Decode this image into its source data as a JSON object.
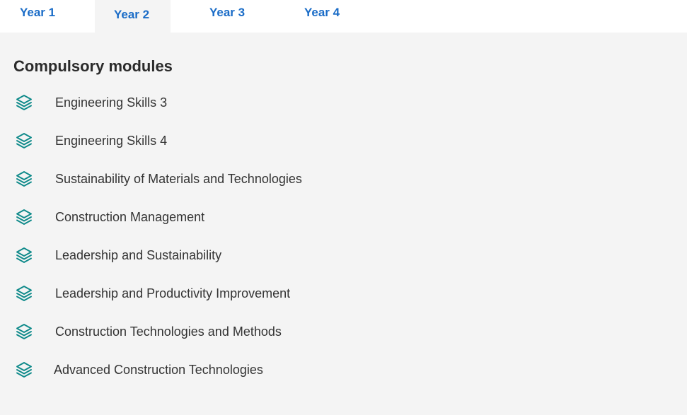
{
  "tabs": [
    {
      "label": "Year 1",
      "active": false
    },
    {
      "label": "Year 2",
      "active": true
    },
    {
      "label": "Year 3",
      "active": false
    },
    {
      "label": "Year 4",
      "active": false
    }
  ],
  "section": {
    "title": "Compulsory modules"
  },
  "modules": [
    {
      "label": "Engineering Skills 3",
      "icon": "stack-layers-icon"
    },
    {
      "label": "Engineering Skills 4",
      "icon": "stack-layers-icon"
    },
    {
      "label": "Sustainability of Materials and Technologies",
      "icon": "stack-layers-icon"
    },
    {
      "label": "Construction Management",
      "icon": "stack-layers-icon"
    },
    {
      "label": "Leadership and Sustainability",
      "icon": "stack-layers-icon"
    },
    {
      "label": "Leadership and Productivity Improvement",
      "icon": "stack-layers-icon"
    },
    {
      "label": "Construction Technologies and Methods",
      "icon": "stack-layers-icon"
    },
    {
      "label": "Advanced Construction Technologies",
      "icon": "stack-layers-icon"
    }
  ],
  "colors": {
    "tab_text": "#1a6cc7",
    "icon": "#0f8a8a",
    "panel_bg": "#f4f4f4",
    "heading": "#2b2b2b",
    "module_text": "#333333"
  }
}
